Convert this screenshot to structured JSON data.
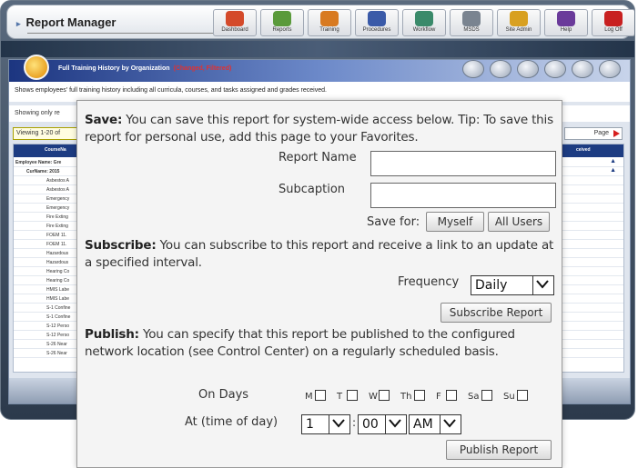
{
  "app": {
    "title": "Report Manager"
  },
  "nav": [
    {
      "label": "Dashboard",
      "icon": "dashboard-icon",
      "color": "#d44a2a"
    },
    {
      "label": "Reports",
      "icon": "reports-icon",
      "color": "#5a9a3a"
    },
    {
      "label": "Training",
      "icon": "training-icon",
      "color": "#d87a20"
    },
    {
      "label": "Procedures",
      "icon": "procedures-icon",
      "color": "#3a5aa8"
    },
    {
      "label": "Workflow",
      "icon": "workflow-icon",
      "color": "#3a8a6a"
    },
    {
      "label": "MSDS",
      "icon": "msds-icon",
      "color": "#7a8490"
    },
    {
      "label": "Site Admin",
      "icon": "site-admin-icon",
      "color": "#d8a020"
    },
    {
      "label": "Help",
      "icon": "help-icon",
      "color": "#6a3a9a"
    },
    {
      "label": "Log Off",
      "icon": "log-off-icon",
      "color": "#c82020"
    }
  ],
  "panel": {
    "title": "Full Training History by Organization",
    "status": "(Changed, Filtered)",
    "description": "Shows employees' full training history including all curricula, courses, and tasks assigned and grades received.",
    "showing": "Showing only re",
    "viewing": "Viewing 1-20 of",
    "page_label": "Page",
    "columns": {
      "course": "CourseNa",
      "received": "ceived"
    },
    "rows": [
      "Employee Name: Gre",
      "CurName: 2015",
      "Asbestos A",
      "Asbestos A",
      "Emergency",
      "Emergency",
      "Fire Exting",
      "Fire Exting",
      "FOEM 11.",
      "FOEM 11.",
      "Hazardous",
      "Hazardous",
      "Hearing Co",
      "Hearing Co",
      "HMIS Labe",
      "HMIS Labe",
      "S-1 Confine",
      "S-1 Confine",
      "S-12 Perso",
      "S-12 Perso",
      "S-26 Near",
      "S-26 Near"
    ]
  },
  "dialog": {
    "save_heading": "Save:",
    "save_text": "You can save this report for system-wide access below. Tip: To save this report for personal use, add this page to your Favorites.",
    "report_name_label": "Report Name",
    "report_name_value": "",
    "subcaption_label": "Subcaption",
    "subcaption_value": "",
    "save_for_label": "Save for:",
    "myself_button": "Myself",
    "all_users_button": "All Users",
    "subscribe_heading": "Subscribe:",
    "subscribe_text": "You can subscribe to this report and receive a link to an update at a specified interval.",
    "frequency_label": "Frequency",
    "frequency_value": "Daily",
    "subscribe_button": "Subscribe Report",
    "publish_heading": "Publish:",
    "publish_text": "You can specify that this report be published to the configured network location (see Control Center) on a regularly scheduled basis.",
    "on_days_label": "On Days",
    "days": [
      "M",
      "T",
      "W",
      "Th",
      "F",
      "Sa",
      "Su"
    ],
    "time_label": "At (time of day)",
    "hour": "1",
    "minute": "00",
    "ampm": "AM",
    "colon": ":",
    "publish_button": "Publish Report"
  }
}
